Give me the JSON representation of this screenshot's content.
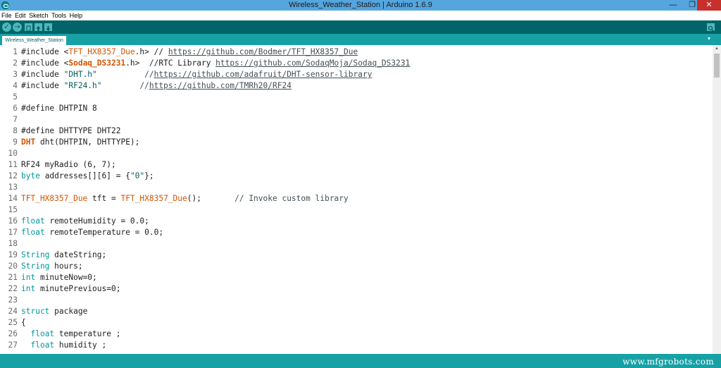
{
  "window": {
    "title": "Wireless_Weather_Station | Arduino 1.6.9",
    "minimize_glyph": "—",
    "maximize_glyph": "❐",
    "close_glyph": "✕"
  },
  "menu": [
    "File",
    "Edit",
    "Sketch",
    "Tools",
    "Help"
  ],
  "toolbar": {
    "buttons": [
      {
        "name": "verify",
        "icon": "checkmark-icon",
        "glyph": "✓"
      },
      {
        "name": "upload",
        "icon": "right-arrow-icon",
        "glyph": "→"
      },
      {
        "name": "new",
        "icon": "new-file-icon"
      },
      {
        "name": "open",
        "icon": "up-arrow-icon"
      },
      {
        "name": "save",
        "icon": "down-arrow-icon"
      }
    ],
    "serial_monitor_icon": "magnifier-icon",
    "serial_monitor_glyph": "⌕"
  },
  "tabs": [
    {
      "label": "Wireless_Weather_Station"
    }
  ],
  "tab_menu_glyph": "▼",
  "code_lines": [
    {
      "n": "1",
      "tokens": [
        {
          "t": "#include <"
        },
        {
          "t": "TFT_HX8357_Due",
          "c": "lib"
        },
        {
          "t": ".h> // "
        },
        {
          "t": "https://github.com/Bodmer/TFT_HX8357_Due",
          "c": "url"
        }
      ]
    },
    {
      "n": "2",
      "tokens": [
        {
          "t": "#include <"
        },
        {
          "t": "Sodaq_DS3231",
          "c": "libb"
        },
        {
          "t": ".h>  //RTC Library "
        },
        {
          "t": "https://github.com/SodaqMoja/Sodaq_DS3231",
          "c": "url"
        }
      ]
    },
    {
      "n": "3",
      "tokens": [
        {
          "t": "#include "
        },
        {
          "t": "\"DHT.h\"",
          "c": "str"
        },
        {
          "t": "          //",
          "c": "cmt"
        },
        {
          "t": "https://github.com/adafruit/DHT-sensor-library",
          "c": "url"
        }
      ]
    },
    {
      "n": "4",
      "tokens": [
        {
          "t": "#include "
        },
        {
          "t": "\"RF24.h\"",
          "c": "str"
        },
        {
          "t": "        //",
          "c": "cmt"
        },
        {
          "t": "https://github.com/TMRh20/RF24",
          "c": "url"
        }
      ]
    },
    {
      "n": "5",
      "tokens": []
    },
    {
      "n": "6",
      "tokens": [
        {
          "t": "#define DHTPIN 8"
        }
      ]
    },
    {
      "n": "7",
      "tokens": []
    },
    {
      "n": "8",
      "tokens": [
        {
          "t": "#define DHTTYPE DHT22"
        }
      ]
    },
    {
      "n": "9",
      "tokens": [
        {
          "t": "DHT",
          "c": "libb"
        },
        {
          "t": " dht(DHTPIN, DHTTYPE);"
        }
      ]
    },
    {
      "n": "10",
      "tokens": []
    },
    {
      "n": "11",
      "tokens": [
        {
          "t": "RF24 myRadio (6, 7);"
        }
      ]
    },
    {
      "n": "12",
      "tokens": [
        {
          "t": "byte",
          "c": "kw"
        },
        {
          "t": " addresses[][6] = {"
        },
        {
          "t": "\"0\"",
          "c": "str"
        },
        {
          "t": "};"
        }
      ]
    },
    {
      "n": "13",
      "tokens": []
    },
    {
      "n": "14",
      "tokens": [
        {
          "t": "TFT_HX8357_Due",
          "c": "lib"
        },
        {
          "t": " tft = "
        },
        {
          "t": "TFT_HX8357_Due",
          "c": "lib"
        },
        {
          "t": "();       "
        },
        {
          "t": "// Invoke custom library",
          "c": "cmt"
        }
      ]
    },
    {
      "n": "15",
      "tokens": []
    },
    {
      "n": "16",
      "tokens": [
        {
          "t": "float",
          "c": "kw"
        },
        {
          "t": " remoteHumidity = 0.0;"
        }
      ]
    },
    {
      "n": "17",
      "tokens": [
        {
          "t": "float",
          "c": "kw"
        },
        {
          "t": " remoteTemperature = 0.0;"
        }
      ]
    },
    {
      "n": "18",
      "tokens": []
    },
    {
      "n": "19",
      "tokens": [
        {
          "t": "String",
          "c": "kw"
        },
        {
          "t": " dateString;"
        }
      ]
    },
    {
      "n": "20",
      "tokens": [
        {
          "t": "String",
          "c": "kw"
        },
        {
          "t": " hours;"
        }
      ]
    },
    {
      "n": "21",
      "tokens": [
        {
          "t": "int",
          "c": "kw"
        },
        {
          "t": " minuteNow=0;"
        }
      ]
    },
    {
      "n": "22",
      "tokens": [
        {
          "t": "int",
          "c": "kw"
        },
        {
          "t": " minutePrevious=0;"
        }
      ]
    },
    {
      "n": "23",
      "tokens": []
    },
    {
      "n": "24",
      "tokens": [
        {
          "t": "struct",
          "c": "kw"
        },
        {
          "t": " package"
        }
      ]
    },
    {
      "n": "25",
      "tokens": [
        {
          "t": "{"
        }
      ]
    },
    {
      "n": "26",
      "tokens": [
        {
          "t": "  "
        },
        {
          "t": "float",
          "c": "kw"
        },
        {
          "t": " temperature ;"
        }
      ]
    },
    {
      "n": "27",
      "tokens": [
        {
          "t": "  "
        },
        {
          "t": "float",
          "c": "kw"
        },
        {
          "t": " humidity ;"
        }
      ]
    }
  ],
  "scrollbar": {
    "up_glyph": "▲"
  },
  "watermark": "www.mfgrobots.com",
  "colors": {
    "titlebar": "#55a6df",
    "toolbar": "#006468",
    "tabbar": "#17a1a5",
    "keyword": "#00979c",
    "library": "#d35400",
    "close_button": "#c7302b"
  }
}
